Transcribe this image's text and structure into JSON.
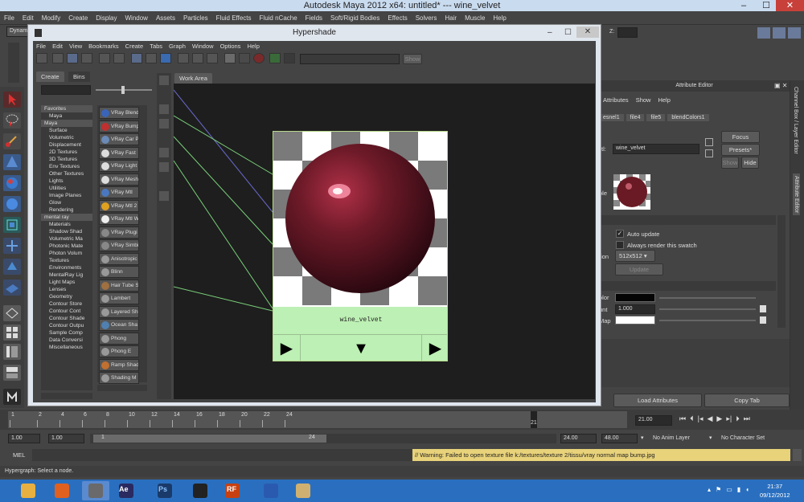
{
  "window": {
    "title": "Autodesk Maya 2012 x64: untitled*   ---   wine_velvet",
    "minimize": "–",
    "maximize": "☐",
    "close": "✕"
  },
  "menubar": [
    "File",
    "Edit",
    "Modify",
    "Create",
    "Display",
    "Window",
    "Assets",
    "Particles",
    "Fluid Effects",
    "Fluid nCache",
    "Fields",
    "Soft/Rigid Bodies",
    "Effects",
    "Solvers",
    "Hair",
    "Muscle",
    "Help"
  ],
  "statusline": {
    "menuset": "Dynam",
    "z_label": "Z:"
  },
  "hypershade": {
    "title": "Hypershade",
    "menu": [
      "File",
      "Edit",
      "View",
      "Bookmarks",
      "Create",
      "Tabs",
      "Graph",
      "Window",
      "Options",
      "Help"
    ],
    "show_button": "Show",
    "tabs": {
      "create": "Create",
      "bins": "Bins"
    },
    "tree": [
      "Favorites",
      "Maya",
      "Maya",
      "Surface",
      "Volumetric",
      "Displacement",
      "2D Textures",
      "3D Textures",
      "Env Textures",
      "Other Textures",
      "Lights",
      "Utilities",
      "Image Planes",
      "Glow",
      "Rendering",
      "mental ray",
      "Materials",
      "Shadow Shad",
      "Volumetric Ma",
      "Photonic Mate",
      "Photon Volum",
      "Textures",
      "Environments",
      "MentalRay Lig",
      "Light Maps",
      "Lenses",
      "Geometry",
      "Contour Store",
      "Contour Cont",
      "Contour Shade",
      "Contour Outpu",
      "Sample Comp",
      "Data Conversi",
      "Miscellaneous"
    ],
    "nodes": [
      {
        "label": "VRay Blend",
        "color": "#3a64b8"
      },
      {
        "label": "VRay Bump",
        "color": "#c03030"
      },
      {
        "label": "VRay Car P",
        "color": "#6a8ab8"
      },
      {
        "label": "VRay Fast",
        "color": "#dddddd"
      },
      {
        "label": "VRay Light",
        "color": "#dddddd"
      },
      {
        "label": "VRay Mesh",
        "color": "#dddddd"
      },
      {
        "label": "VRay Mtl",
        "color": "#4a78c0"
      },
      {
        "label": "VRay Mtl 2",
        "color": "#e0a020"
      },
      {
        "label": "VRay Mtl W",
        "color": "#eeeeee"
      },
      {
        "label": "VRay Plugi",
        "color": "#888888"
      },
      {
        "label": "VRay Simbi",
        "color": "#888888"
      },
      {
        "label": "Anisotropic",
        "color": "#999999"
      },
      {
        "label": "Blinn",
        "color": "#999999"
      },
      {
        "label": "Hair Tube S",
        "color": "#a07040"
      },
      {
        "label": "Lambert",
        "color": "#999999"
      },
      {
        "label": "Layered Sh",
        "color": "#999999"
      },
      {
        "label": "Ocean Sha",
        "color": "#5080b0"
      },
      {
        "label": "Phong",
        "color": "#999999"
      },
      {
        "label": "Phong E",
        "color": "#999999"
      },
      {
        "label": "Ramp Shad",
        "color": "#c07030"
      },
      {
        "label": "Shading M",
        "color": "#999999"
      }
    ],
    "work_tab": "Work Area",
    "swatch": {
      "material_name": "wine_velvet",
      "play_left": "▶",
      "play_down": "▼",
      "play_right": "▶"
    }
  },
  "attribute_editor": {
    "title": "Attribute Editor",
    "menu": [
      "Attributes",
      "Show",
      "Help"
    ],
    "tabs": [
      "esnel1",
      "file4",
      "file5",
      "blendColors1"
    ],
    "name_label": "tl:",
    "name_value": "wine_velvet",
    "focus": "Focus",
    "presets": "Presets*",
    "show": "Show",
    "hide": "Hide",
    "sample_label": "ple",
    "auto_update": "Auto update",
    "always_render": "Always render this swatch",
    "resolution_label": "tion",
    "resolution": "512x512",
    "update": "Update",
    "color_label": "olor",
    "amount_label": "unt",
    "amount_value": "1.000",
    "map_label": "Map",
    "load_attributes": "Load Attributes",
    "copy_tab": "Copy Tab",
    "side_tabs": [
      "Channel Box / Layer Editor",
      "Attribute Editor"
    ]
  },
  "timeline": {
    "ticks": [
      "1",
      "2",
      "4",
      "6",
      "8",
      "10",
      "12",
      "14",
      "16",
      "18",
      "20",
      "22",
      "24"
    ],
    "current": "21",
    "current_field": "21.00"
  },
  "range": {
    "start": "1.00",
    "start2": "1.00",
    "slider_start": "1",
    "slider_end": "24",
    "end": "24.00",
    "end2": "48.00",
    "anim_layer": "No Anim Layer",
    "char_set": "No Character Set"
  },
  "cmdline": {
    "label": "MEL",
    "warning": "// Warning: Failed to open texture file k:/textures/texture 2/tissu/vray normal map bump.jpg"
  },
  "helpline": "Hypergraph: Select a node.",
  "taskbar": {
    "time": "21:37",
    "date": "09/12/2012",
    "apps": [
      {
        "name": "explorer-icon",
        "color": "#e8b040"
      },
      {
        "name": "firefox-icon",
        "color": "#e06020"
      },
      {
        "name": "maya-icon",
        "color": "#6a6a6a"
      },
      {
        "name": "aftereffects-icon",
        "color": "#2a2a60"
      },
      {
        "name": "photoshop-icon",
        "color": "#1a3a6a"
      },
      {
        "name": "app-x-icon",
        "color": "#222222"
      },
      {
        "name": "realflow-icon",
        "color": "#c84010"
      },
      {
        "name": "word-icon",
        "color": "#2a5ab0"
      },
      {
        "name": "paint-icon",
        "color": "#d0b070"
      }
    ],
    "labels": {
      "ae": "Ae",
      "ps": "Ps",
      "rf": "RF"
    }
  }
}
